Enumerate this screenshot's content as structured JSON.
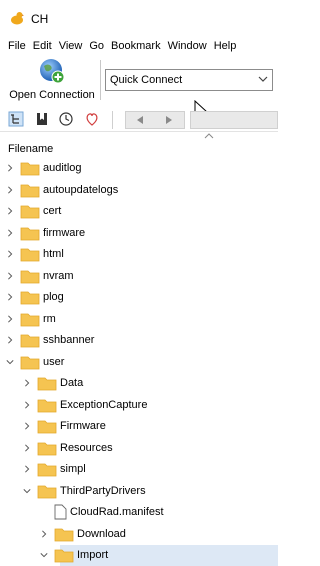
{
  "window": {
    "title": "CH"
  },
  "menu": [
    "File",
    "Edit",
    "View",
    "Go",
    "Bookmark",
    "Window",
    "Help"
  ],
  "toolbar": {
    "open_connection_label": "Open Connection",
    "quick_connect_value": "Quick Connect"
  },
  "browser": {
    "column_header": "Filename",
    "rows": [
      {
        "name": "auditlog",
        "depth": 0,
        "type": "folder",
        "expanded": false
      },
      {
        "name": "autoupdatelogs",
        "depth": 0,
        "type": "folder",
        "expanded": false
      },
      {
        "name": "cert",
        "depth": 0,
        "type": "folder",
        "expanded": false
      },
      {
        "name": "firmware",
        "depth": 0,
        "type": "folder",
        "expanded": false
      },
      {
        "name": "html",
        "depth": 0,
        "type": "folder",
        "expanded": false
      },
      {
        "name": "nvram",
        "depth": 0,
        "type": "folder",
        "expanded": false
      },
      {
        "name": "plog",
        "depth": 0,
        "type": "folder",
        "expanded": false
      },
      {
        "name": "rm",
        "depth": 0,
        "type": "folder",
        "expanded": false
      },
      {
        "name": "sshbanner",
        "depth": 0,
        "type": "folder",
        "expanded": false
      },
      {
        "name": "user",
        "depth": 0,
        "type": "folder",
        "expanded": true
      },
      {
        "name": "Data",
        "depth": 1,
        "type": "folder",
        "expanded": false
      },
      {
        "name": "ExceptionCapture",
        "depth": 1,
        "type": "folder",
        "expanded": false
      },
      {
        "name": "Firmware",
        "depth": 1,
        "type": "folder",
        "expanded": false
      },
      {
        "name": "Resources",
        "depth": 1,
        "type": "folder",
        "expanded": false
      },
      {
        "name": "simpl",
        "depth": 1,
        "type": "folder",
        "expanded": false
      },
      {
        "name": "ThirdPartyDrivers",
        "depth": 1,
        "type": "folder",
        "expanded": true
      },
      {
        "name": "CloudRad.manifest",
        "depth": 2,
        "type": "file",
        "expanded": false
      },
      {
        "name": "Download",
        "depth": 2,
        "type": "folder",
        "expanded": false
      },
      {
        "name": "Import",
        "depth": 2,
        "type": "folder",
        "expanded": true,
        "selected": true
      }
    ]
  },
  "colors": {
    "folder": "#f5c451",
    "folder_dark": "#e3a82b",
    "selection": "#dde8f5"
  }
}
